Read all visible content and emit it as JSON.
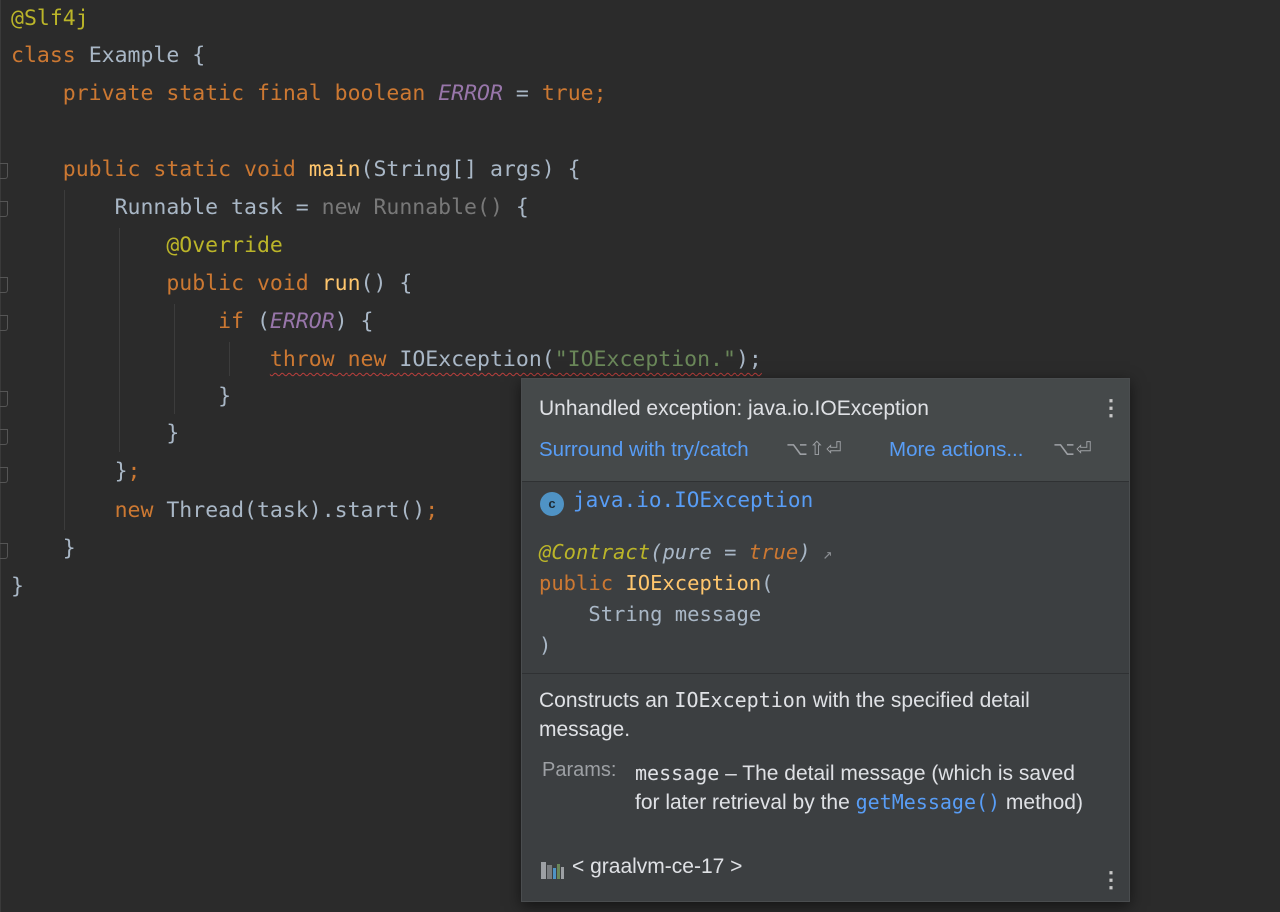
{
  "code": {
    "line1": "@Slf4j",
    "kw_class": "class",
    "class_name": "Example",
    "brace_open": "{",
    "brace_close": "}",
    "kw_private": "private",
    "kw_static": "static",
    "kw_final": "final",
    "kw_boolean": "boolean",
    "const_error": "ERROR",
    "equals": "=",
    "kw_true": "true",
    "semicolon": ";",
    "kw_public": "public",
    "kw_void": "void",
    "fn_main": "main",
    "main_params": "(String[] args) {",
    "runnable_decl": "Runnable task = ",
    "new_runnable": "new Runnable()",
    "ann_override": "@Override",
    "fn_run": "run",
    "run_params": "() {",
    "kw_if": "if",
    "paren_open": "(",
    "paren_close_brace": ") {",
    "kw_throw": "throw",
    "kw_new": "new",
    "ioexception_call": "IOException(",
    "str_msg": "\"IOException.\"",
    "call_close": ");",
    "close_semicolon_brace": "}",
    "thread_start": "Thread(task).start()"
  },
  "popup": {
    "title": "Unhandled exception: java.io.IOException",
    "kebab": "⋮",
    "action_surround": "Surround with try/catch",
    "shortcut_surround": "⌥⇧⏎",
    "action_more": "More actions...",
    "shortcut_more": "⌥⏎",
    "class_icon_letter": "c",
    "class_name": "java.io.IOException",
    "sig_contract": "@Contract",
    "sig_contract_open": "(",
    "sig_pure": "pure",
    "sig_eq": " = ",
    "sig_true": "true",
    "sig_contract_close": ")",
    "sig_arrow": "↗",
    "sig_public": "public",
    "sig_ctor": "IOException",
    "sig_ctor_open": "(",
    "sig_param": "    String message",
    "sig_close": ")",
    "desc_pre": "Constructs an ",
    "desc_code": "IOException",
    "desc_post": " with the specified detail message.",
    "params_label": "Params:",
    "param_name": "message",
    "param_desc_pre": " – The detail message (which is saved for later retrieval by the ",
    "param_link": "getMessage()",
    "param_desc_post": " method)",
    "sdk": "< graalvm-ce-17 >"
  }
}
